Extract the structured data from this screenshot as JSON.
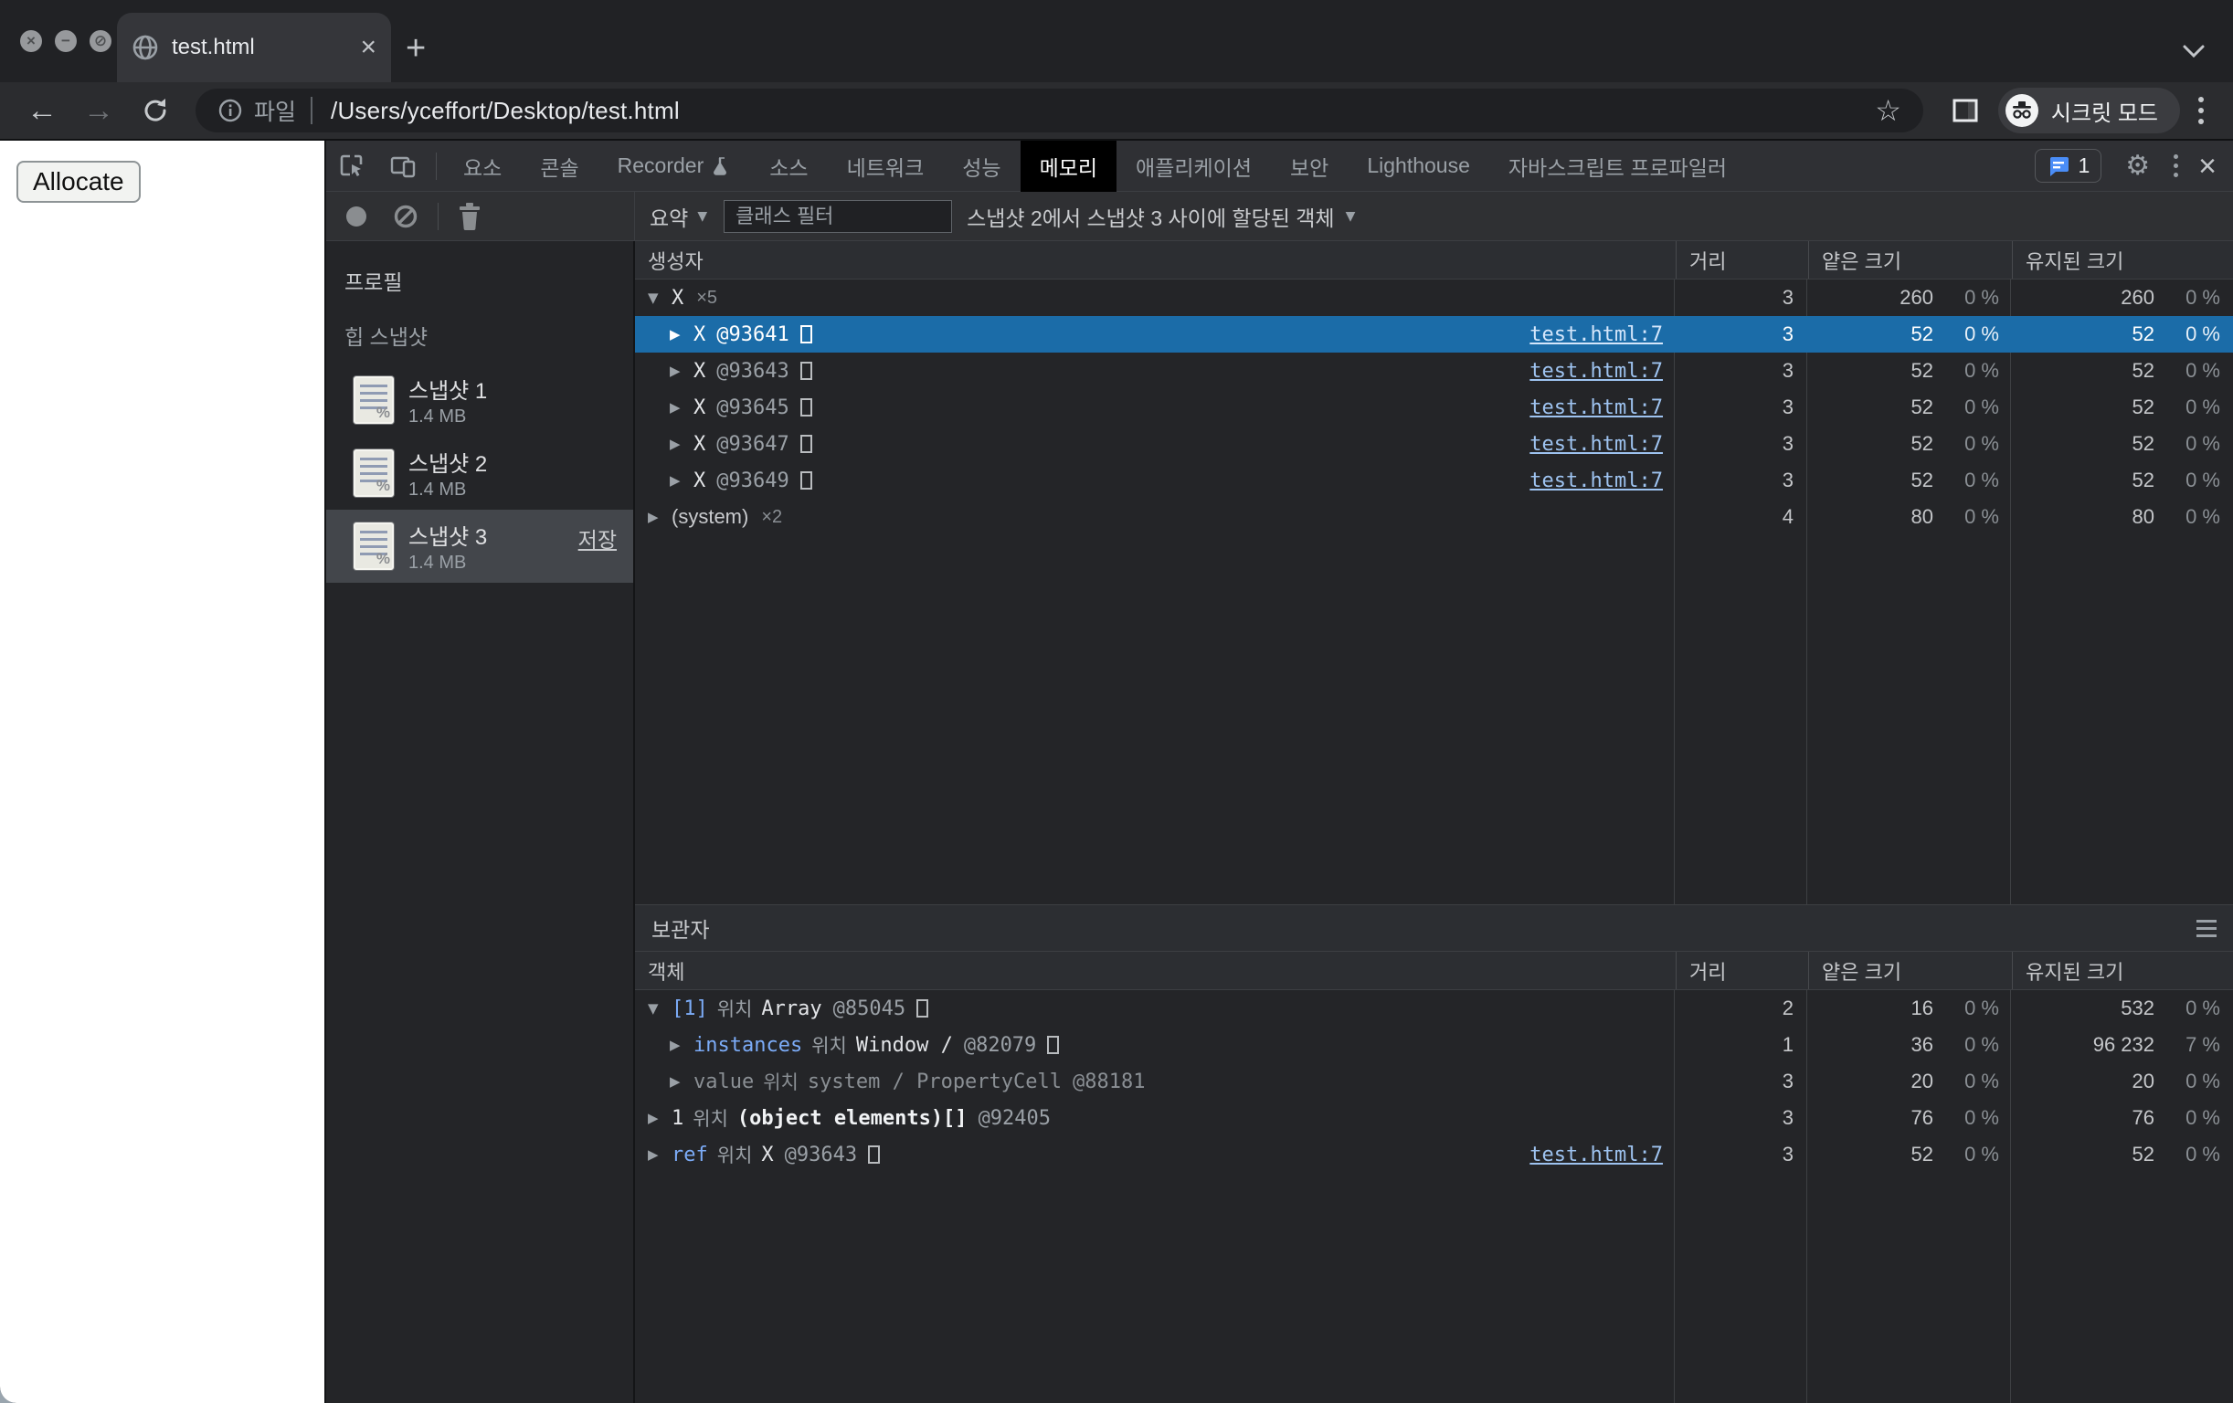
{
  "colors": {
    "selection_blue": "#1b6ca8",
    "property_blue": "#7cacf8",
    "link_blue": "#9ec3f0",
    "issues_blue": "#4a8df8",
    "devtools_bg": "#242528",
    "active_tab_bg": "#000000"
  },
  "browser": {
    "window_controls": {
      "close": "×",
      "minimize": "−",
      "zoom": "⊘"
    },
    "tab": {
      "title": "test.html",
      "close": "×"
    },
    "new_tab": "+",
    "nav": {
      "back": "←",
      "forward": "→"
    },
    "omnibox": {
      "chip": "파일",
      "url": "/Users/yceffort/Desktop/test.html",
      "star": "☆"
    },
    "incognito_label": "시크릿 모드"
  },
  "page": {
    "allocate_label": "Allocate"
  },
  "devtools": {
    "tabs": [
      {
        "label": "요소"
      },
      {
        "label": "콘솔"
      },
      {
        "label": "Recorder"
      },
      {
        "label": "소스"
      },
      {
        "label": "네트워크"
      },
      {
        "label": "성능"
      },
      {
        "label": "메모리"
      },
      {
        "label": "애플리케이션"
      },
      {
        "label": "보안"
      },
      {
        "label": "Lighthouse"
      },
      {
        "label": "자바스크립트 프로파일러"
      }
    ],
    "issues_count": "1",
    "close_label": "×",
    "toolbar": {
      "summary": "요약",
      "filter_placeholder": "클래스 필터",
      "range": "스냅샷 2에서 스냅샷 3 사이에 할당된 객체"
    },
    "sidebar": {
      "profiles": "프로필",
      "heap_snapshots": "힙 스냅샷",
      "items": [
        {
          "name": "스냅샷 1",
          "size": "1.4 MB"
        },
        {
          "name": "스냅샷 2",
          "size": "1.4 MB"
        },
        {
          "name": "스냅샷 3",
          "size": "1.4 MB",
          "save": "저장"
        }
      ]
    },
    "constructors": {
      "headers": {
        "object": "생성자",
        "distance": "거리",
        "shallow": "얕은 크기",
        "retained": "유지된 크기"
      },
      "rows": [
        {
          "name": "X",
          "count": "×5",
          "distance": "3",
          "shallow": "260",
          "shallow_pct": "0 %",
          "retained": "260",
          "retained_pct": "0 %"
        },
        {
          "name": "X",
          "id": "@93641",
          "link": "test.html:7",
          "distance": "3",
          "shallow": "52",
          "shallow_pct": "0 %",
          "retained": "52",
          "retained_pct": "0 %"
        },
        {
          "name": "X",
          "id": "@93643",
          "link": "test.html:7",
          "distance": "3",
          "shallow": "52",
          "shallow_pct": "0 %",
          "retained": "52",
          "retained_pct": "0 %"
        },
        {
          "name": "X",
          "id": "@93645",
          "link": "test.html:7",
          "distance": "3",
          "shallow": "52",
          "shallow_pct": "0 %",
          "retained": "52",
          "retained_pct": "0 %"
        },
        {
          "name": "X",
          "id": "@93647",
          "link": "test.html:7",
          "distance": "3",
          "shallow": "52",
          "shallow_pct": "0 %",
          "retained": "52",
          "retained_pct": "0 %"
        },
        {
          "name": "X",
          "id": "@93649",
          "link": "test.html:7",
          "distance": "3",
          "shallow": "52",
          "shallow_pct": "0 %",
          "retained": "52",
          "retained_pct": "0 %"
        },
        {
          "name": "(system)",
          "count": "×2",
          "distance": "4",
          "shallow": "80",
          "shallow_pct": "0 %",
          "retained": "80",
          "retained_pct": "0 %"
        }
      ]
    },
    "retainers": {
      "title": "보관자",
      "headers": {
        "object": "객체",
        "distance": "거리",
        "shallow": "얕은 크기",
        "retained": "유지된 크기"
      },
      "rows": [
        {
          "prop": "[1]",
          "in": "위치",
          "obj": "Array",
          "id": "@85045",
          "distance": "2",
          "shallow": "16",
          "shallow_pct": "0 %",
          "retained": "532",
          "retained_pct": "0 %"
        },
        {
          "prop": "instances",
          "in": "위치",
          "obj": "Window /",
          "id": "@82079",
          "distance": "1",
          "shallow": "36",
          "shallow_pct": "0 %",
          "retained": "96 232",
          "retained_pct": "7 %"
        },
        {
          "prop": "value",
          "in": "위치",
          "obj": "system / PropertyCell",
          "id": "@88181",
          "distance": "3",
          "shallow": "20",
          "shallow_pct": "0 %",
          "retained": "20",
          "retained_pct": "0 %"
        },
        {
          "prop": "1",
          "in": "위치",
          "obj": "(object elements)[]",
          "id": "@92405",
          "distance": "3",
          "shallow": "76",
          "shallow_pct": "0 %",
          "retained": "76",
          "retained_pct": "0 %"
        },
        {
          "prop": "ref",
          "in": "위치",
          "obj": "X",
          "id": "@93643",
          "link": "test.html:7",
          "distance": "3",
          "shallow": "52",
          "shallow_pct": "0 %",
          "retained": "52",
          "retained_pct": "0 %"
        }
      ]
    }
  }
}
